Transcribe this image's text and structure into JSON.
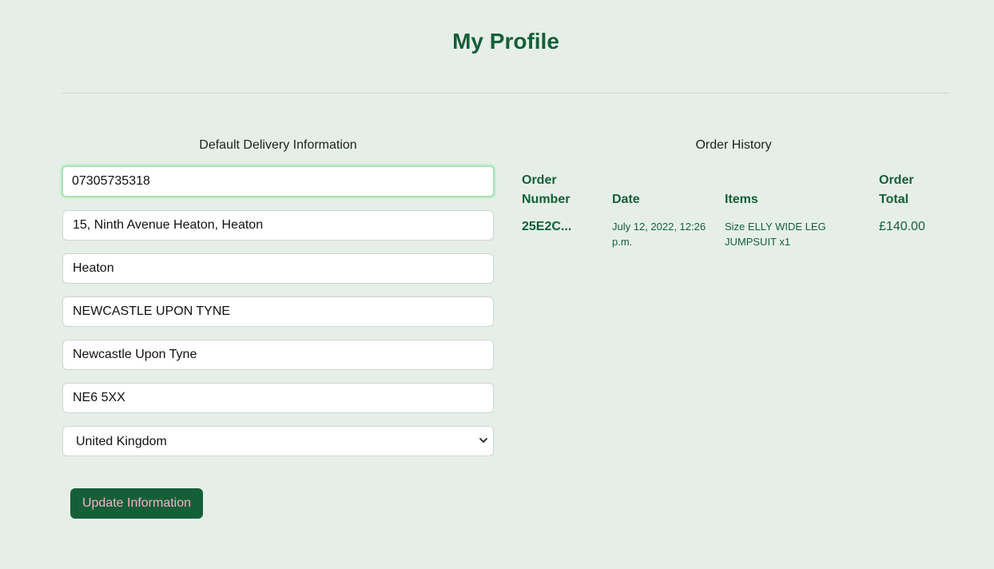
{
  "page": {
    "title": "My Profile"
  },
  "delivery": {
    "heading": "Default Delivery Information",
    "phone": "07305735318",
    "street_address1": "15, Ninth Avenue Heaton, Heaton",
    "street_address2": "Heaton",
    "town_or_city": "NEWCASTLE UPON TYNE",
    "county": "Newcastle Upon Tyne",
    "postcode": "NE6 5XX",
    "country": {
      "selected": "United Kingdom"
    },
    "update_label": "Update Information"
  },
  "orders": {
    "heading": "Order History",
    "columns": {
      "order_number": "Order Number",
      "date": "Date",
      "items": "Items",
      "order_total": "Order Total"
    },
    "rows": [
      {
        "order_number": "25E2C...",
        "date": "July 12, 2022, 12:26 p.m.",
        "items": "Size ELLY WIDE LEG JUMPSUIT x1",
        "order_total": "£140.00"
      }
    ]
  },
  "colors": {
    "background": "#e5efe8",
    "accent": "#155f38",
    "button_text": "#f2b3c6",
    "focus_ring": "#a8e2b6"
  }
}
